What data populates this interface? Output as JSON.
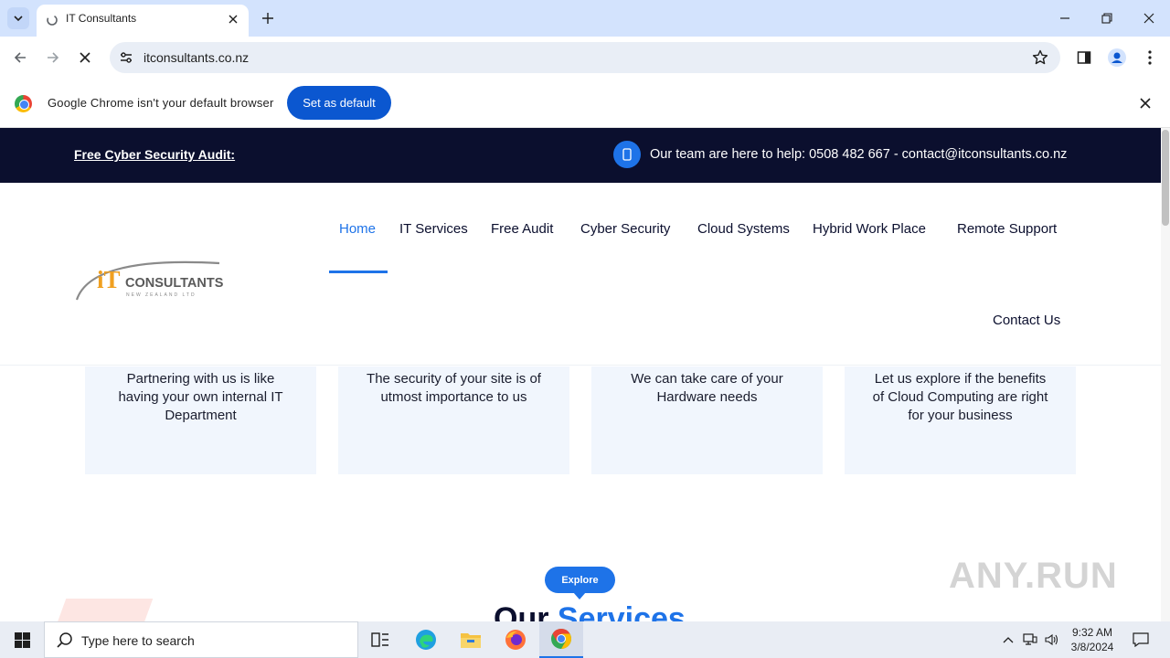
{
  "browser": {
    "tab_title": "IT Consultants",
    "url": "itconsultants.co.nz",
    "infobar_message": "Google Chrome isn't your default browser",
    "infobar_button": "Set as default"
  },
  "site": {
    "topbar": {
      "audit_link": "Free Cyber Security Audit:",
      "help_text": "Our team are here to help: 0508 482 667 - contact@itconsultants.co.nz"
    },
    "logo": {
      "brand_main": "iT",
      "brand_word": "CONSULTANTS",
      "brand_sub": "NEW ZEALAND LTD"
    },
    "nav": {
      "home": "Home",
      "it_services": "IT Services",
      "free_audit": "Free Audit",
      "cyber_security": "Cyber Security",
      "cloud_systems": "Cloud Systems",
      "hybrid_work_place": "Hybrid Work Place",
      "remote_support": "Remote Support",
      "contact_us": "Contact Us"
    },
    "cards": [
      {
        "text": "Partnering with us is like having your own internal IT Department"
      },
      {
        "text": "The security of your site is of utmost importance to us"
      },
      {
        "text": "We can take care of your Hardware needs"
      },
      {
        "text": "Let us explore if the benefits of Cloud Computing are right for your business"
      }
    ],
    "explore_badge": "Explore",
    "services_title_part1": "Our",
    "services_title_part2": "Services"
  },
  "watermark": "ANY.RUN",
  "taskbar": {
    "search_placeholder": "Type here to search",
    "time": "9:32 AM",
    "date": "3/8/2024"
  },
  "colors": {
    "topbar_bg": "#0b0f2e",
    "accent_blue": "#1e73e8",
    "card_bg": "#f1f6fd",
    "chrome_blue": "#0b57d0"
  }
}
